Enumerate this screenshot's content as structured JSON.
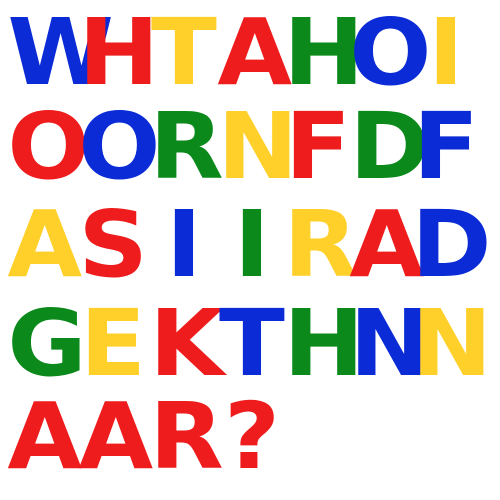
{
  "colors": {
    "blue": "#0a2bd6",
    "red": "#ee1c1c",
    "yellow": "#ffd02a",
    "green": "#0b8a1b"
  },
  "rows": [
    [
      {
        "char": "W",
        "color": "#0a2bd6"
      },
      {
        "char": "H",
        "color": "#ee1c1c"
      },
      {
        "char": "T",
        "color": "#ffd02a"
      },
      {
        "char": "A",
        "color": "#ee1c1c"
      },
      {
        "char": "H",
        "color": "#0b8a1b"
      },
      {
        "char": "O",
        "color": "#0a2bd6"
      },
      {
        "char": "I",
        "color": "#ffd02a"
      }
    ],
    [
      {
        "char": "O",
        "color": "#ee1c1c"
      },
      {
        "char": "O",
        "color": "#0a2bd6"
      },
      {
        "char": "R",
        "color": "#0b8a1b"
      },
      {
        "char": "N",
        "color": "#ffd02a"
      },
      {
        "char": "F",
        "color": "#ee1c1c"
      },
      {
        "char": "D",
        "color": "#0b8a1b"
      },
      {
        "char": "F",
        "color": "#0a2bd6"
      }
    ],
    [
      {
        "char": "A",
        "color": "#ffd02a"
      },
      {
        "char": "S",
        "color": "#ee1c1c"
      },
      {
        "char": "I",
        "color": "#0a2bd6"
      },
      {
        "char": "I",
        "color": "#0b8a1b"
      },
      {
        "char": "R",
        "color": "#ffd02a"
      },
      {
        "char": "A",
        "color": "#ee1c1c"
      },
      {
        "char": "D",
        "color": "#0a2bd6"
      }
    ],
    [
      {
        "char": "G",
        "color": "#0b8a1b"
      },
      {
        "char": "E",
        "color": "#ffd02a"
      },
      {
        "char": "K",
        "color": "#ee1c1c"
      },
      {
        "char": "T",
        "color": "#0a2bd6"
      },
      {
        "char": "H",
        "color": "#0b8a1b"
      },
      {
        "char": "N",
        "color": "#0a2bd6"
      },
      {
        "char": "N",
        "color": "#ffd02a"
      }
    ],
    [
      {
        "char": "A",
        "color": "#ee1c1c"
      },
      {
        "char": "A",
        "color": "#ee1c1c"
      },
      {
        "char": "R",
        "color": "#ee1c1c"
      },
      {
        "char": "?",
        "color": "#ee1c1c"
      }
    ]
  ]
}
